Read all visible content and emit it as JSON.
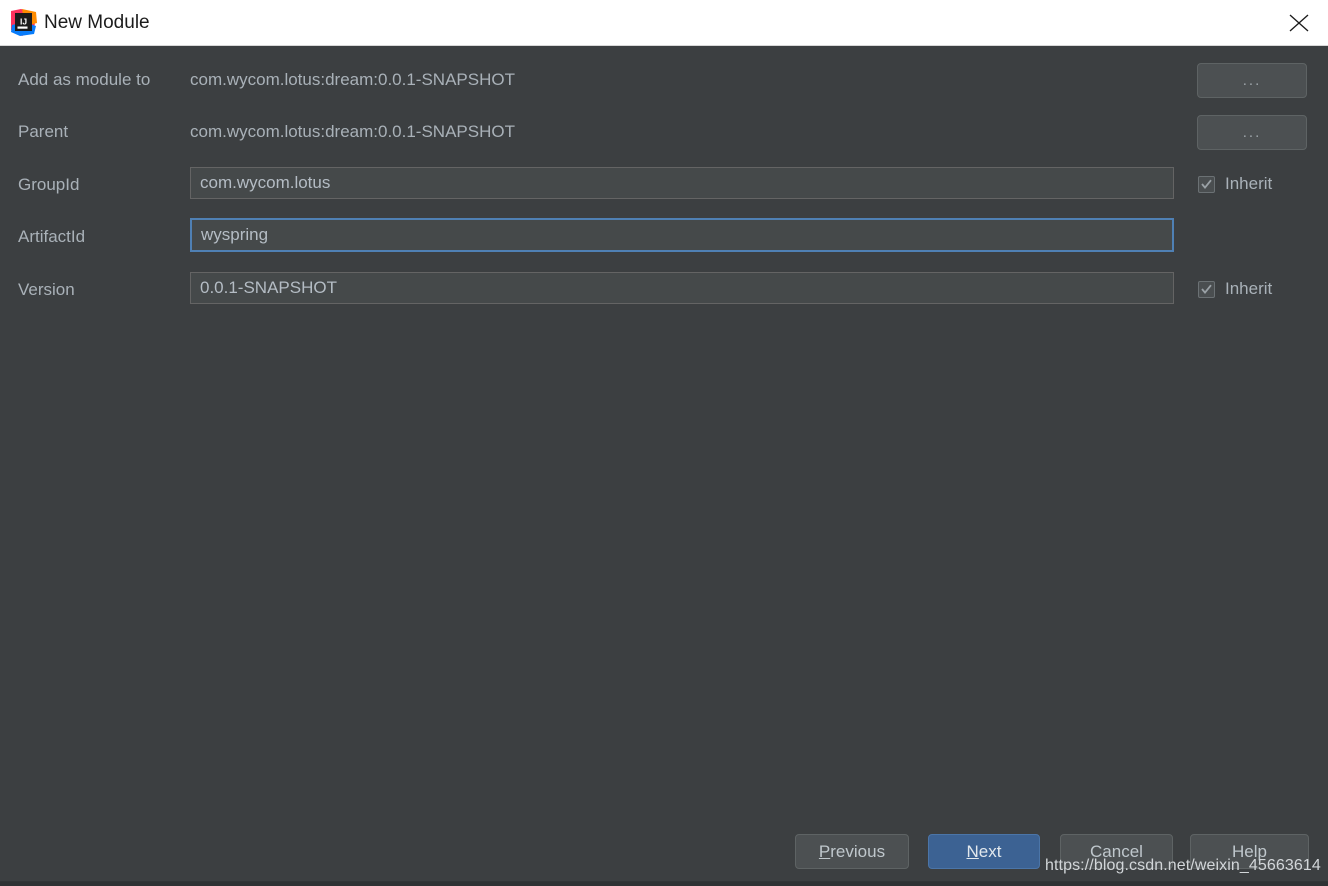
{
  "window": {
    "title": "New Module",
    "logo_icon": "intellij-idea-logo",
    "close_icon": "close-icon"
  },
  "form": {
    "rows": [
      {
        "label": "Add as module to",
        "type": "readonly",
        "value": "com.wycom.lotus:dream:0.0.1-SNAPSHOT",
        "browse_label": "..."
      },
      {
        "label": "Parent",
        "type": "readonly",
        "value": "com.wycom.lotus:dream:0.0.1-SNAPSHOT",
        "browse_label": "..."
      },
      {
        "label": "GroupId",
        "type": "input",
        "value": "com.wycom.lotus",
        "placeholder": "",
        "focused": false,
        "inherit_label": "Inherit",
        "inherit_checked": true
      },
      {
        "label": "ArtifactId",
        "type": "input",
        "value": "wyspring",
        "placeholder": "",
        "focused": true,
        "inherit_label": null,
        "inherit_checked": false
      },
      {
        "label": "Version",
        "type": "input",
        "value": "0.0.1-SNAPSHOT",
        "placeholder": "",
        "focused": false,
        "inherit_label": "Inherit",
        "inherit_checked": true
      }
    ]
  },
  "footer": {
    "previous_label": "Previous",
    "previous_mnemonic": "P",
    "next_label": "Next",
    "next_mnemonic": "N",
    "cancel_label": "Cancel",
    "help_label": "Help"
  },
  "watermark": {
    "text": "https://blog.csdn.net/weixin_45663614"
  },
  "colors": {
    "dialog_background": "#3c3f41",
    "titlebar_background": "#ffffff",
    "label_text": "#a9b1b8",
    "input_border": "#646464",
    "focus_border": "#4f80b4",
    "primary_button": "#3c6293",
    "button_background": "#4c5052"
  }
}
